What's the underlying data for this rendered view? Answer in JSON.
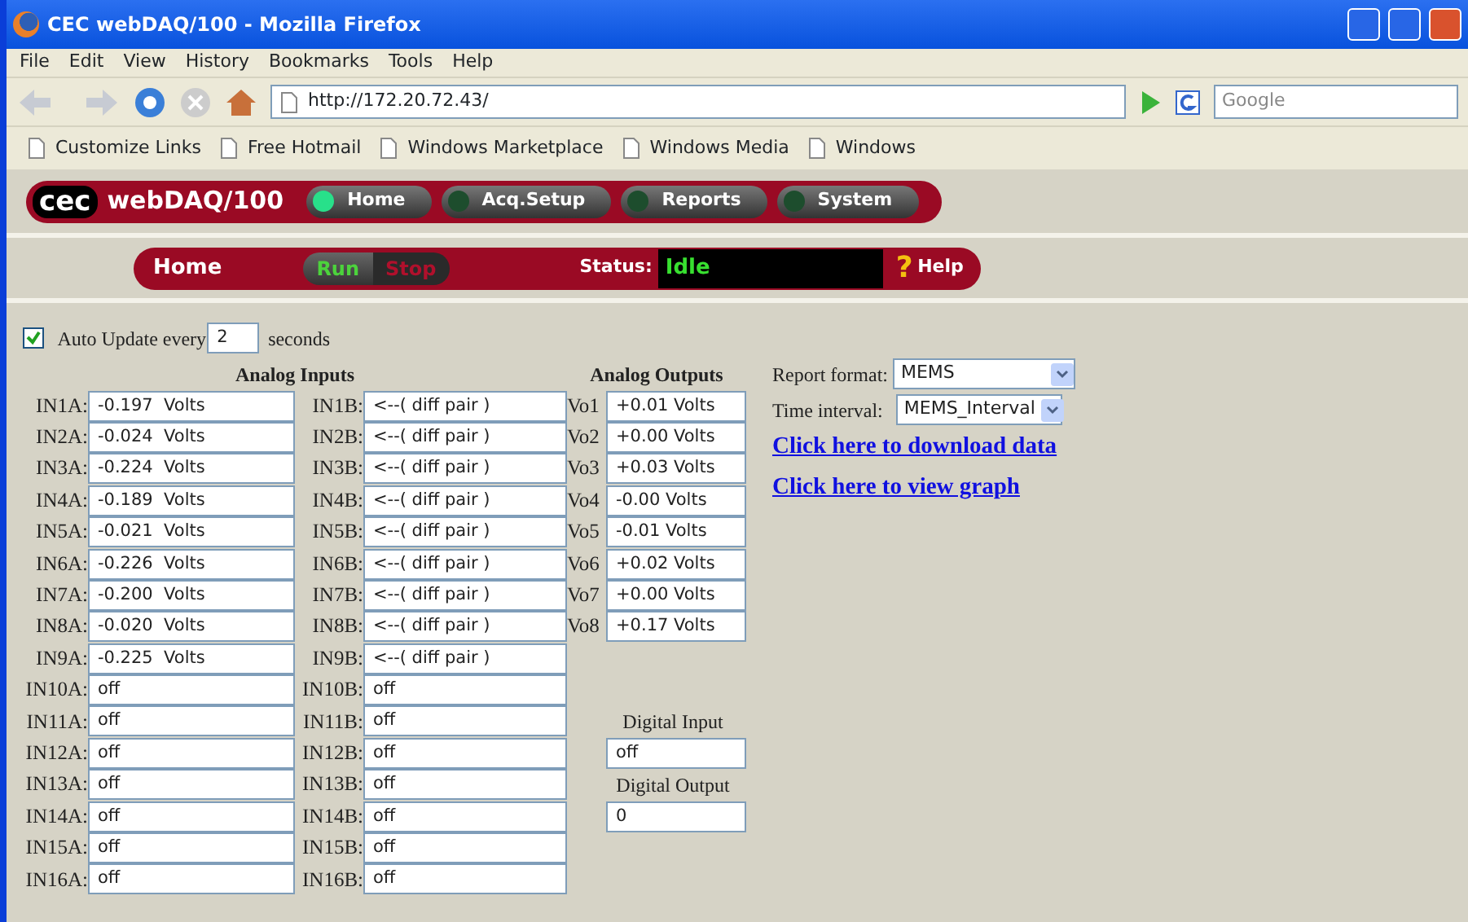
{
  "window": {
    "title": "CEC webDAQ/100 - Mozilla Firefox"
  },
  "menu": [
    "File",
    "Edit",
    "View",
    "History",
    "Bookmarks",
    "Tools",
    "Help"
  ],
  "address": {
    "value": "http://172.20.72.43/"
  },
  "search": {
    "placeholder": "Google"
  },
  "bookmarks": [
    "Customize Links",
    "Free Hotmail",
    "Windows Marketplace",
    "Windows Media",
    "Windows"
  ],
  "header": {
    "logo": "cec",
    "brand": "webDAQ/100",
    "tabs": [
      {
        "label": "Home",
        "selected": true
      },
      {
        "label": "Acq.Setup",
        "selected": false
      },
      {
        "label": "Reports",
        "selected": false
      },
      {
        "label": "System",
        "selected": false
      }
    ]
  },
  "subbar": {
    "page": "Home",
    "run": "Run",
    "stop": "Stop",
    "status_label": "Status:",
    "status": "Idle",
    "help_icon": "?",
    "help": "Help"
  },
  "auto_update": {
    "checked": true,
    "label": "Auto Update every",
    "value": "2",
    "suffix": "seconds"
  },
  "analog_inputs": {
    "heading": "Analog Inputs",
    "rows": [
      {
        "a_label": "IN1A:",
        "a_value": "-0.197  Volts",
        "b_label": "IN1B:",
        "b_value": "<--( diff pair )"
      },
      {
        "a_label": "IN2A:",
        "a_value": "-0.024  Volts",
        "b_label": "IN2B:",
        "b_value": "<--( diff pair )"
      },
      {
        "a_label": "IN3A:",
        "a_value": "-0.224  Volts",
        "b_label": "IN3B:",
        "b_value": "<--( diff pair )"
      },
      {
        "a_label": "IN4A:",
        "a_value": "-0.189  Volts",
        "b_label": "IN4B:",
        "b_value": "<--( diff pair )"
      },
      {
        "a_label": "IN5A:",
        "a_value": "-0.021  Volts",
        "b_label": "IN5B:",
        "b_value": "<--( diff pair )"
      },
      {
        "a_label": "IN6A:",
        "a_value": "-0.226  Volts",
        "b_label": "IN6B:",
        "b_value": "<--( diff pair )"
      },
      {
        "a_label": "IN7A:",
        "a_value": "-0.200  Volts",
        "b_label": "IN7B:",
        "b_value": "<--( diff pair )"
      },
      {
        "a_label": "IN8A:",
        "a_value": "-0.020  Volts",
        "b_label": "IN8B:",
        "b_value": "<--( diff pair )"
      },
      {
        "a_label": "IN9A:",
        "a_value": "-0.225  Volts",
        "b_label": "IN9B:",
        "b_value": "<--( diff pair )"
      },
      {
        "a_label": "IN10A:",
        "a_value": "off",
        "b_label": "IN10B:",
        "b_value": "off"
      },
      {
        "a_label": "IN11A:",
        "a_value": "off",
        "b_label": "IN11B:",
        "b_value": "off"
      },
      {
        "a_label": "IN12A:",
        "a_value": "off",
        "b_label": "IN12B:",
        "b_value": "off"
      },
      {
        "a_label": "IN13A:",
        "a_value": "off",
        "b_label": "IN13B:",
        "b_value": "off"
      },
      {
        "a_label": "IN14A:",
        "a_value": "off",
        "b_label": "IN14B:",
        "b_value": "off"
      },
      {
        "a_label": "IN15A:",
        "a_value": "off",
        "b_label": "IN15B:",
        "b_value": "off"
      },
      {
        "a_label": "IN16A:",
        "a_value": "off",
        "b_label": "IN16B:",
        "b_value": "off"
      }
    ]
  },
  "analog_outputs": {
    "heading": "Analog Outputs",
    "rows": [
      {
        "label": "Vo1",
        "value": "+0.01 Volts"
      },
      {
        "label": "Vo2",
        "value": "+0.00 Volts"
      },
      {
        "label": "Vo3",
        "value": "+0.03 Volts"
      },
      {
        "label": "Vo4",
        "value": "-0.00 Volts"
      },
      {
        "label": "Vo5",
        "value": "-0.01 Volts"
      },
      {
        "label": "Vo6",
        "value": "+0.02 Volts"
      },
      {
        "label": "Vo7",
        "value": "+0.00 Volts"
      },
      {
        "label": "Vo8",
        "value": "+0.17 Volts"
      }
    ]
  },
  "digital_input": {
    "label": "Digital Input",
    "value": "off"
  },
  "digital_output": {
    "label": "Digital Output",
    "value": "0"
  },
  "report": {
    "format_label": "Report format:",
    "format": "MEMS",
    "interval_label": "Time interval:",
    "interval": "MEMS_Interval",
    "links": [
      "Click here to download data",
      "Click here to view graph"
    ]
  }
}
